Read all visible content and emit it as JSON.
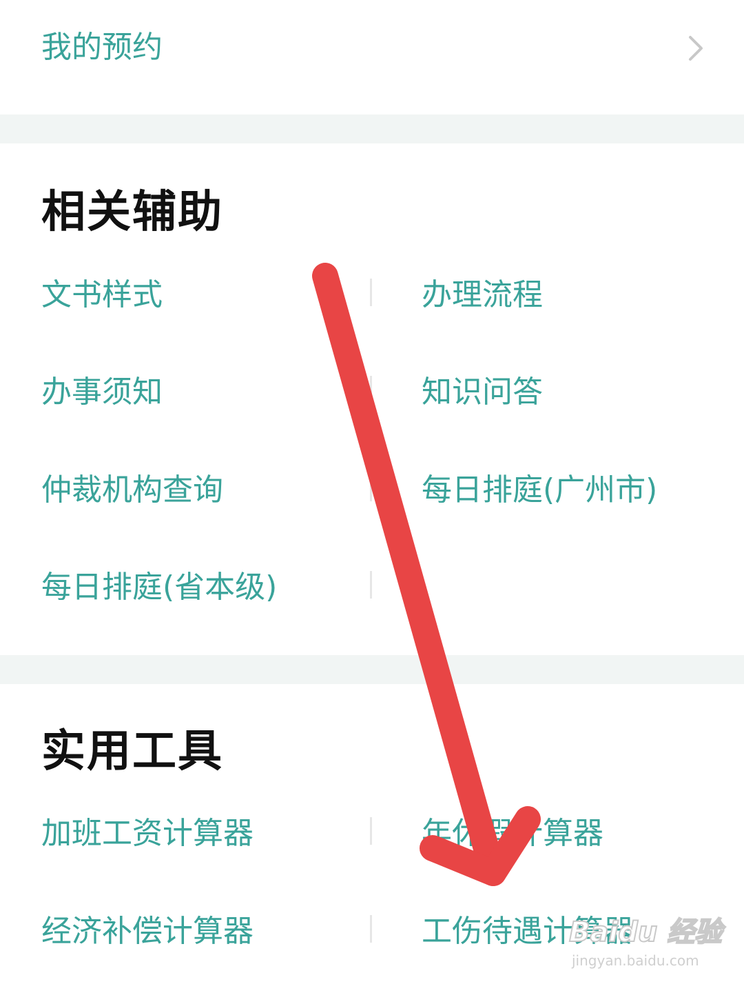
{
  "appointment": {
    "label": "我的预约",
    "chevron_icon": "chevron-right-icon"
  },
  "sections": [
    {
      "title": "相关辅助",
      "rows": [
        {
          "left": "文书样式",
          "right": "办理流程"
        },
        {
          "left": "办事须知",
          "right": "知识问答"
        },
        {
          "left": "仲裁机构查询",
          "right": "每日排庭(广州市)"
        },
        {
          "left": "每日排庭(省本级)",
          "right": ""
        }
      ]
    },
    {
      "title": "实用工具",
      "rows": [
        {
          "left": "加班工资计算器",
          "right": "年休假计算器"
        },
        {
          "left": "经济补偿计算器",
          "right": "工伤待遇计算器"
        }
      ]
    }
  ],
  "annotation": {
    "icon": "red-arrow-icon",
    "color": "#e84545"
  },
  "watermark": {
    "logo": "Baidu 经验",
    "url": "jingyan.baidu.com"
  },
  "colors": {
    "accent": "#3aa39a",
    "title": "#111111",
    "separator": "#f1f5f4"
  }
}
